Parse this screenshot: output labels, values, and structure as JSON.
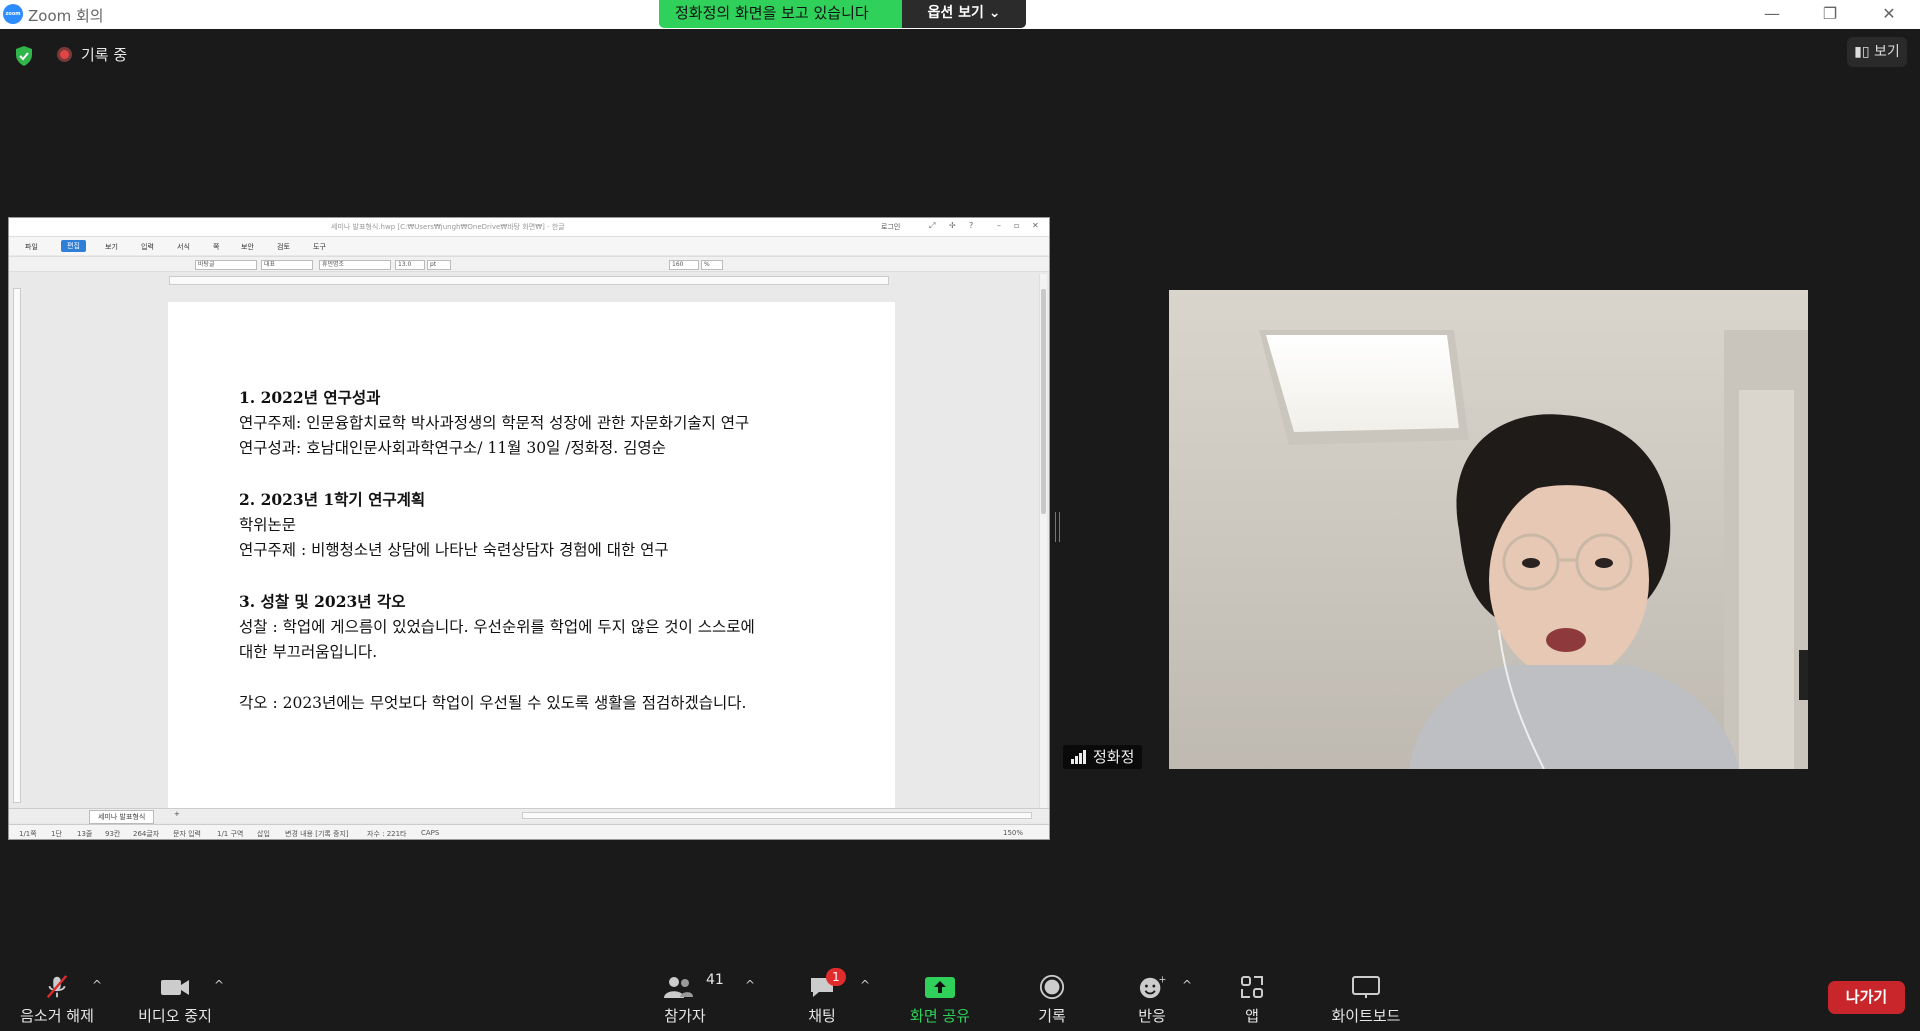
{
  "window": {
    "title": "Zoom 회의",
    "logo_text": "zoom"
  },
  "share_banner": {
    "viewing_text": "정화정의 화면을 보고 있습니다",
    "options_label": "옵션 보기"
  },
  "meeting": {
    "recording_label": "기록 중",
    "view_label": "보기"
  },
  "hwp": {
    "title": "세미나 발표형식.hwp [C:₩Users₩jungh₩OneDrive₩바탕 화면₩] - 한글",
    "login_label": "로그인",
    "menus": [
      "파일",
      "편집",
      "보기",
      "입력",
      "서식",
      "쪽",
      "보안",
      "검토",
      "도구"
    ],
    "active_menu": "편집",
    "toolbar": {
      "style": "바탕글",
      "lang": "대표",
      "font": "휴먼명조",
      "size": "13.0",
      "unit": "pt",
      "zoom": "160",
      "percent": "%"
    },
    "document": {
      "section1_heading": "1. 2022년 연구성과",
      "section1_line1": "연구주제: 인문융합치료학 박사과정생의 학문적 성장에 관한 자문화기술지 연구",
      "section1_line2": "연구성과: 호남대인문사회과학연구소/ 11월 30일 /정화정. 김영순",
      "section2_heading": "2. 2023년 1학기 연구계획",
      "section2_line1": "학위논문",
      "section2_line2": "연구주제 : 비행청소년 상담에 나타난 숙련상담자 경험에 대한 연구",
      "section3_heading": "3. 성찰 및 2023년 각오",
      "section3_line1": "성찰 : 학업에 게으름이 있었습니다. 우선순위를 학업에 두지 않은 것이 스스로에",
      "section3_line2": "대한 부끄러움입니다.",
      "section3_line3": "각오 : 2023년에는 무엇보다 학업이 우선될 수 있도록 생활을 점검하겠습니다."
    },
    "tab_label": "세미나 발표형식",
    "status": [
      "1/1쪽",
      "1단",
      "13줄",
      "93칸",
      "264글자",
      "문자 입력",
      "1/1 구역",
      "삽입",
      "변경 내용 [기록 중지]",
      "자수 : 221타",
      "CAPS"
    ],
    "zoom_status": "150%"
  },
  "participant": {
    "name": "정화정"
  },
  "toolbar": {
    "mute": "음소거 해제",
    "video": "비디오 중지",
    "participants": "참가자",
    "participants_count": "41",
    "chat": "채팅",
    "chat_badge": "1",
    "share": "화면 공유",
    "record": "기록",
    "reactions": "반응",
    "apps": "앱",
    "whiteboard": "화이트보드",
    "leave": "나가기"
  },
  "colors": {
    "accent_green": "#2fd15a",
    "leave_red": "#c8262b",
    "zoom_blue": "#2D8CFF",
    "badge_red": "#e02c2c"
  }
}
